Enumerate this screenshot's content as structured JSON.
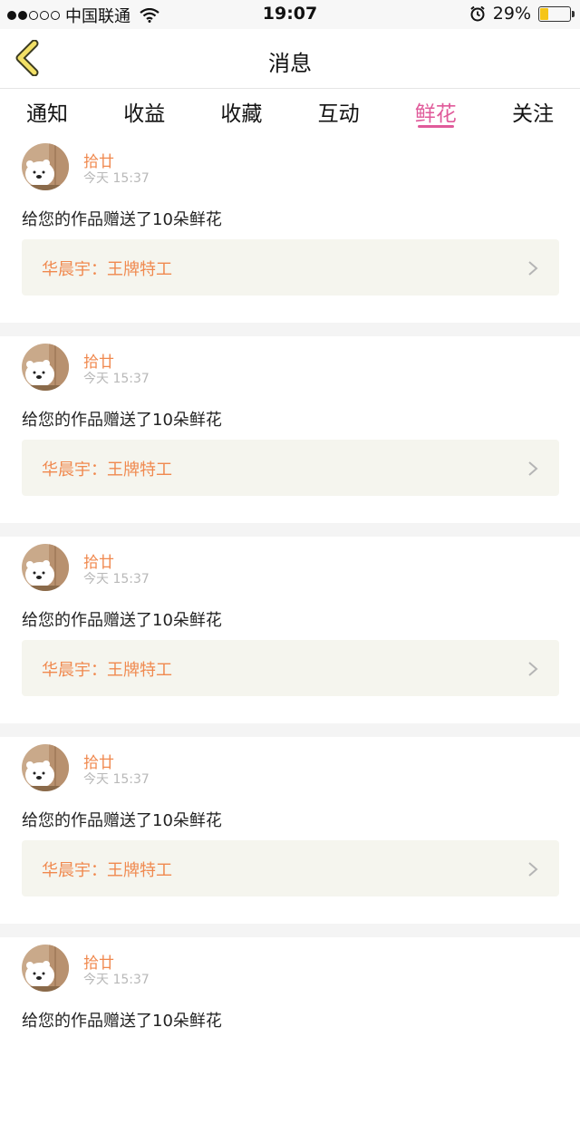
{
  "status": {
    "carrier": "中国联通",
    "time": "19:07",
    "battery": "29%",
    "battery_level": 0.29,
    "signal_bars_filled": 2,
    "signal_bars_total": 5
  },
  "nav": {
    "title": "消息",
    "back_icon": "chevron-left-icon"
  },
  "tabs": [
    {
      "label": "通知"
    },
    {
      "label": "收益"
    },
    {
      "label": "收藏"
    },
    {
      "label": "互动"
    },
    {
      "label": "鲜花",
      "active": true
    },
    {
      "label": "关注"
    }
  ],
  "colors": {
    "accent": "#e05a9a",
    "name": "#f0894f",
    "card_bg": "#f5f5ee",
    "battery": "#f5c518"
  },
  "messages": [
    {
      "user": "拾廿",
      "time": "今天 15:37",
      "text": "给您的作品赠送了10朵鲜花",
      "work": "华晨宇：王牌特工"
    },
    {
      "user": "拾廿",
      "time": "今天 15:37",
      "text": "给您的作品赠送了10朵鲜花",
      "work": "华晨宇：王牌特工"
    },
    {
      "user": "拾廿",
      "time": "今天 15:37",
      "text": "给您的作品赠送了10朵鲜花",
      "work": "华晨宇：王牌特工"
    },
    {
      "user": "拾廿",
      "time": "今天 15:37",
      "text": "给您的作品赠送了10朵鲜花",
      "work": "华晨宇：王牌特工"
    },
    {
      "user": "拾廿",
      "time": "今天 15:37",
      "text": "给您的作品赠送了10朵鲜花",
      "work": ""
    }
  ]
}
